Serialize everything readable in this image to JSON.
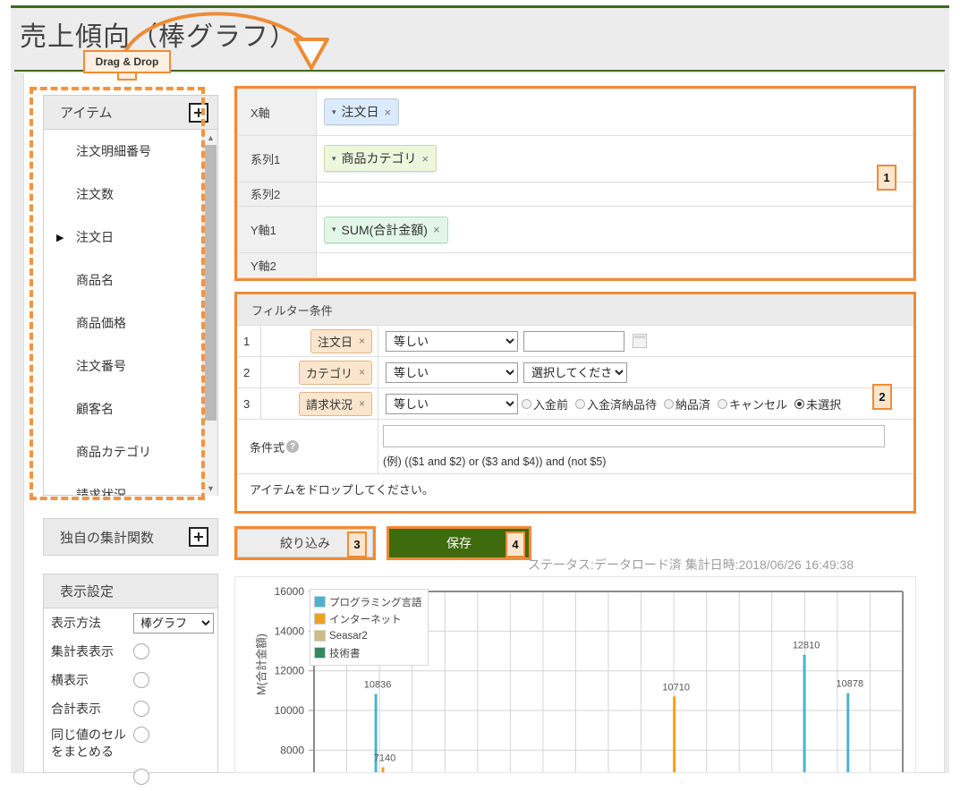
{
  "page": {
    "title": "売上傾向（棒グラフ）",
    "callout_label": "Drag  & Drop",
    "status_text": "ステータス:データロード済  集計日時:2018/06/26 16:49:38"
  },
  "items_panel": {
    "header": "アイテム",
    "add_icon": "plus-icon",
    "items": [
      {
        "label": "注文明細番号",
        "expandable": false
      },
      {
        "label": "注文数",
        "expandable": false
      },
      {
        "label": "注文日",
        "expandable": true
      },
      {
        "label": "商品名",
        "expandable": false
      },
      {
        "label": "商品価格",
        "expandable": false
      },
      {
        "label": "注文番号",
        "expandable": false
      },
      {
        "label": "顧客名",
        "expandable": false
      },
      {
        "label": "商品カテゴリ",
        "expandable": false
      },
      {
        "label": "請求状況",
        "expandable": false
      }
    ],
    "scroll_up_glyph": "▲",
    "scroll_down_glyph": "▼"
  },
  "custom_func_panel": {
    "header": "独自の集計関数",
    "add_icon": "plus-icon"
  },
  "display_settings": {
    "header": "表示設定",
    "method_label": "表示方法",
    "method_value": "棒グラフ",
    "method_options": [
      "棒グラフ"
    ],
    "toggles": [
      {
        "label": "集計表表示",
        "checked": false
      },
      {
        "label": "横表示",
        "checked": false
      },
      {
        "label": "合計表示",
        "checked": false
      },
      {
        "label": "同じ値のセル\nをまとめる",
        "checked": false
      }
    ]
  },
  "axis_mapping": {
    "badge": "1",
    "rows": [
      {
        "key": "X軸",
        "chip": "注文日",
        "chip_style": "blue",
        "caret": "▾",
        "remove": "×"
      },
      {
        "key": "系列1",
        "chip": "商品カテゴリ",
        "chip_style": "green",
        "caret": "▾",
        "remove": "×"
      },
      {
        "key": "系列2",
        "chip": "",
        "chip_style": "",
        "caret": "",
        "remove": ""
      },
      {
        "key": "Y軸1",
        "chip": "SUM(合計金額)",
        "chip_style": "mint",
        "caret": "▾",
        "remove": "×"
      },
      {
        "key": "Y軸2",
        "chip": "",
        "chip_style": "",
        "caret": "",
        "remove": ""
      }
    ]
  },
  "filter": {
    "badge": "2",
    "header": "フィルター条件",
    "rows": [
      {
        "num": "1",
        "chip": "注文日",
        "remove": "×",
        "operator": "等しい",
        "operator_options": [
          "等しい"
        ],
        "value_type": "text",
        "value": "",
        "calendar_icon": "calendar-icon"
      },
      {
        "num": "2",
        "chip": "カテゴリ",
        "remove": "×",
        "operator": "等しい",
        "operator_options": [
          "等しい"
        ],
        "value_type": "select",
        "value": "選択してください",
        "value_options": [
          "選択してください"
        ]
      },
      {
        "num": "3",
        "chip": "請求状況",
        "remove": "×",
        "operator": "等しい",
        "operator_options": [
          "等しい"
        ],
        "value_type": "radios",
        "radios": [
          {
            "label": "入金前",
            "checked": false
          },
          {
            "label": "入金済納品待",
            "checked": false
          },
          {
            "label": "納品済",
            "checked": false
          },
          {
            "label": "キャンセル",
            "checked": false
          },
          {
            "label": "未選択",
            "checked": true
          }
        ]
      }
    ],
    "expr_label": "条件式",
    "expr_help_icon": "help-icon",
    "expr_value": "",
    "expr_hint": "(例)  (($1 and $2) or ($3 and $4)) and (not $5)",
    "drop_hint": "アイテムをドロップしてください。"
  },
  "buttons": {
    "filter_label": "絞り込み",
    "filter_badge": "3",
    "save_label": "保存",
    "save_badge": "4",
    "save_color": "#3f6b0e"
  },
  "chart_data": {
    "type": "bar",
    "title": "",
    "xlabel": "",
    "ylabel": "M(合計金額)",
    "ylim": [
      6800,
      16000
    ],
    "yticks": [
      8000,
      10000,
      12000,
      14000,
      16000
    ],
    "grid": true,
    "legend_position": "top-left",
    "series": [
      {
        "name": "プログラミング言語",
        "color": "#4bb4cc"
      },
      {
        "name": "インターネット",
        "color": "#f0a020"
      },
      {
        "name": "Seasar2",
        "color": "#cfbb84"
      },
      {
        "name": "技術書",
        "color": "#2f8a63"
      }
    ],
    "points": [
      {
        "series": "プログラミング言語",
        "value": 10836,
        "label": "10836",
        "x_frac": 0.105
      },
      {
        "series": "インターネット",
        "value": 7140,
        "label": "7140",
        "x_frac": 0.117
      },
      {
        "series": "インターネット",
        "value": 10710,
        "label": "10710",
        "x_frac": 0.612
      },
      {
        "series": "プログラミング言語",
        "value": 12810,
        "label": "12810",
        "x_frac": 0.833
      },
      {
        "series": "プログラミング言語",
        "value": 10878,
        "label": "10878",
        "x_frac": 0.907
      }
    ]
  }
}
